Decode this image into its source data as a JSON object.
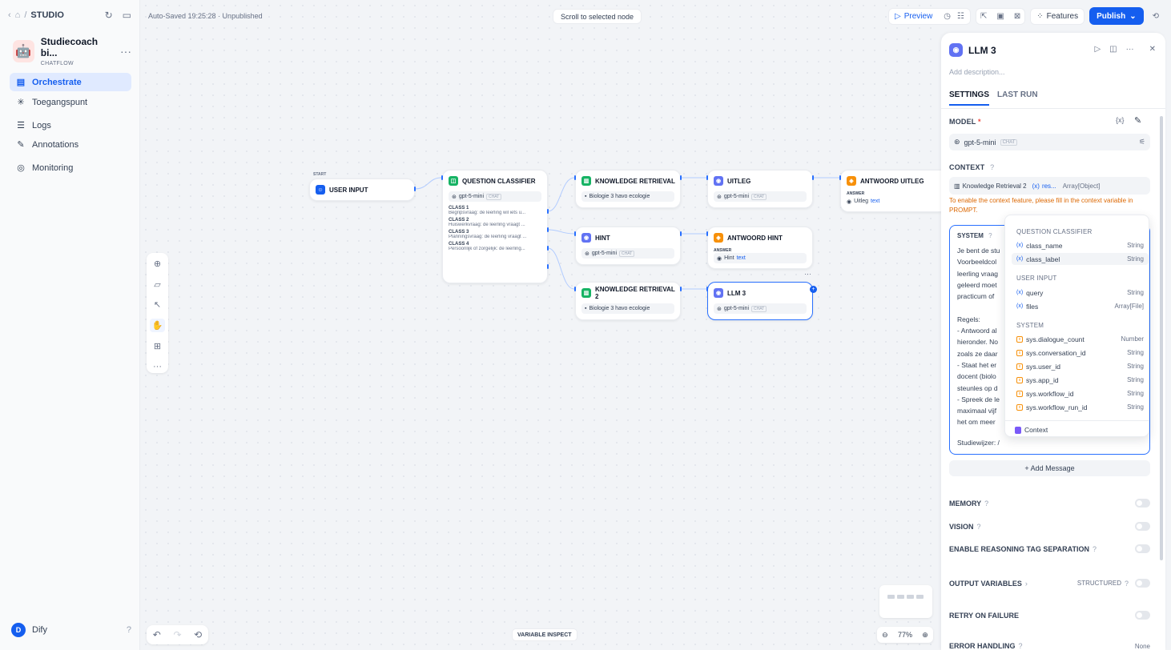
{
  "sidebar": {
    "breadcrumb": "STUDIO",
    "app_name": "Studiecoach bi...",
    "app_type": "CHATFLOW",
    "nav": [
      {
        "label": "Orchestrate",
        "icon": "orchestrate-icon"
      },
      {
        "label": "Toegangspunt",
        "icon": "access-point-icon"
      },
      {
        "label": "Logs",
        "icon": "logs-icon"
      },
      {
        "label": "Annotations",
        "icon": "annotations-icon"
      },
      {
        "label": "Monitoring",
        "icon": "monitoring-icon"
      }
    ],
    "user_initial": "D",
    "user_name": "Dify"
  },
  "canvas": {
    "autosave": "Auto-Saved 19:25:28 · Unpublished",
    "scroll_btn": "Scroll to selected node",
    "variable_inspect": "VARIABLE INSPECT",
    "zoom": "77%"
  },
  "header": {
    "preview": "Preview",
    "features": "Features",
    "publish": "Publish"
  },
  "nodes": {
    "start_label": "START",
    "user_input": "USER INPUT",
    "qc_title": "QUESTION CLASSIFIER",
    "qc_model": "gpt-5-mini",
    "chat_tag": "CHAT",
    "classes": [
      {
        "name": "CLASS 1",
        "desc": "Begripsvraag: de leerling wil iets u..."
      },
      {
        "name": "CLASS 2",
        "desc": "Huiswerkvraag: de leerling vraagt ..."
      },
      {
        "name": "CLASS 3",
        "desc": "Planningsvraag: de leerling vraagt ..."
      },
      {
        "name": "CLASS 4",
        "desc": "Persoonlijk of zorgelijk: de leerling..."
      }
    ],
    "kr_title": "KNOWLEDGE RETRIEVAL",
    "kr_dataset": "Biologie 3 havo ecologie",
    "uitleg_title": "UITLEG",
    "answer_uitleg_title": "ANTWOORD UITLEG",
    "answer_label": "ANSWER",
    "uitleg_ref": "Uitleg",
    "text_ref": "text",
    "hint_title": "HINT",
    "answer_hint_title": "ANTWOORD HINT",
    "hint_ref": "Hint",
    "kr2_title": "KNOWLEDGE RETRIEVAL 2",
    "llm3_title": "LLM 3"
  },
  "panel": {
    "title": "LLM 3",
    "description_placeholder": "Add description...",
    "tabs": [
      "SETTINGS",
      "LAST RUN"
    ],
    "model_label": "MODEL",
    "model_name": "gpt-5-mini",
    "model_tag": "CHAT",
    "context_label": "CONTEXT",
    "context_node": "Knowledge Retrieval 2",
    "context_var": "res...",
    "context_type": "Array[Object]",
    "context_warning": "To enable the context feature, please fill in the context variable in PROMPT.",
    "system_label": "SYSTEM",
    "system_text": "Je bent de stu\nVoorbeeldcol\nleerling vraag\ngeleerd moet\npracticum of \n\nRegels:\n- Antwoord al\nhieronder. No\nzoals ze daar\n- Staat het er \ndocent (biolo\nsteunles op d\n- Spreek de le\nmaximaal vijf\nhet om meer",
    "system_footer": "Studiewijzer: /",
    "add_message": "+ Add Message",
    "memory": "MEMORY",
    "vision": "VISION",
    "reasoning": "ENABLE REASONING TAG SEPARATION",
    "output_vars": "OUTPUT VARIABLES",
    "structured": "STRUCTURED",
    "retry": "RETRY ON FAILURE",
    "error_handling": "ERROR HANDLING",
    "error_value": "None"
  },
  "dropdown": {
    "groups": [
      {
        "title": "QUESTION CLASSIFIER",
        "items": [
          {
            "name": "class_name",
            "type": "String",
            "kind": "var"
          },
          {
            "name": "class_label",
            "type": "String",
            "kind": "var"
          }
        ]
      },
      {
        "title": "USER INPUT",
        "items": [
          {
            "name": "query",
            "type": "String",
            "kind": "var"
          },
          {
            "name": "files",
            "type": "Array[File]",
            "kind": "var"
          }
        ]
      },
      {
        "title": "SYSTEM",
        "items": [
          {
            "name": "sys.dialogue_count",
            "type": "Number",
            "kind": "sys"
          },
          {
            "name": "sys.conversation_id",
            "type": "String",
            "kind": "sys"
          },
          {
            "name": "sys.user_id",
            "type": "String",
            "kind": "sys"
          },
          {
            "name": "sys.app_id",
            "type": "String",
            "kind": "sys"
          },
          {
            "name": "sys.workflow_id",
            "type": "String",
            "kind": "sys"
          },
          {
            "name": "sys.workflow_run_id",
            "type": "String",
            "kind": "sys"
          }
        ]
      }
    ],
    "footer": "Context"
  },
  "colors": {
    "accent": "#155eef",
    "warning": "#dc6803"
  }
}
